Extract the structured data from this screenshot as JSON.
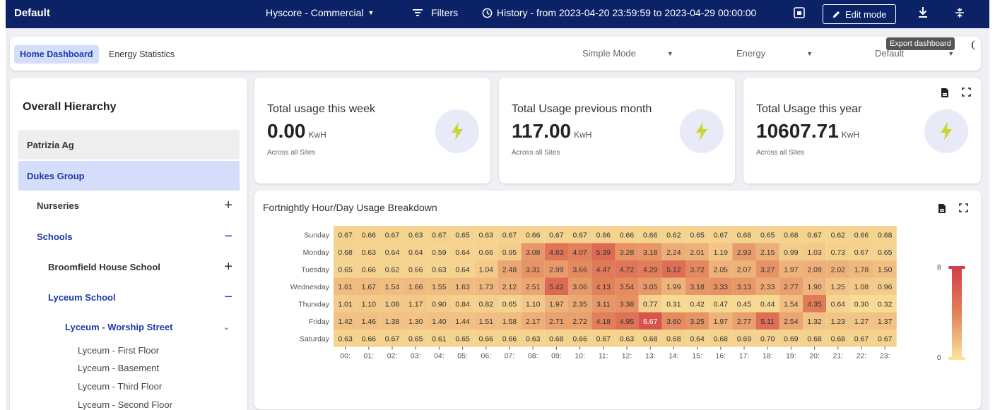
{
  "topbar": {
    "title": "Default",
    "dashboard": "Hyscore - Commercial",
    "filters": "Filters",
    "history": "History - from 2023-04-20 23:59:59 to 2023-04-29 00:00:00",
    "edit_mode": "Edit mode"
  },
  "tabs": [
    {
      "label": "Home Dashboard",
      "active": true
    },
    {
      "label": "Energy Statistics",
      "active": false
    }
  ],
  "selects": {
    "mode": "Simple Mode",
    "metric": "Energy",
    "view": "Default"
  },
  "tooltip": "Export dashboard",
  "sidebar": {
    "title": "Overall Hierarchy",
    "nodes": [
      {
        "label": "Patrizia Ag",
        "control": ""
      },
      {
        "label": "Dukes Group",
        "control": ""
      },
      {
        "label": "Nurseries",
        "control": "+"
      },
      {
        "label": "Schools",
        "control": "−"
      },
      {
        "label": "Broomfield House School",
        "control": "+"
      },
      {
        "label": "Lyceum School",
        "control": "−"
      },
      {
        "label": "Lyceum - Worship Street",
        "control": "⌄"
      }
    ],
    "leaves": [
      "Lyceum - First Floor",
      "Lyceum - Basement",
      "Lyceum - Third Floor",
      "Lyceum - Second Floor"
    ]
  },
  "cards": [
    {
      "title": "Total usage this week",
      "value": "0.00",
      "unit": "KwH",
      "sub": "Across all Sites"
    },
    {
      "title": "Total Usage previous month",
      "value": "117.00",
      "unit": "KwH",
      "sub": "Across all Sites"
    },
    {
      "title": "Total Usage this year",
      "value": "10607.71",
      "unit": "KwH",
      "sub": "Across all Sites"
    }
  ],
  "heatmap": {
    "title": "Fortnightly Hour/Day Usage Breakdown",
    "scale_max_label": "8",
    "scale_min_label": "0"
  },
  "colors": {
    "navy": "#0b2366",
    "accent_blue": "#1e3aa8",
    "tab_active_bg": "#d4defa",
    "low": "#f9e39a",
    "high": "#d33f47"
  },
  "chart_data": {
    "type": "heatmap",
    "title": "Fortnightly Hour/Day Usage Breakdown",
    "x": [
      "00:",
      "01:",
      "02:",
      "03:",
      "04:",
      "05:",
      "06:",
      "07:",
      "08:",
      "09:",
      "10:",
      "11:",
      "12:",
      "13:",
      "14:",
      "15:",
      "16:",
      "17:",
      "18:",
      "19:",
      "20:",
      "21:",
      "22:",
      "23:"
    ],
    "y": [
      "Sunday",
      "Monday",
      "Tuesday",
      "Wednesday",
      "Thursday",
      "Friday",
      "Saturday"
    ],
    "values": [
      [
        0.67,
        0.66,
        0.67,
        0.63,
        0.67,
        0.65,
        0.63,
        0.67,
        0.66,
        0.67,
        0.67,
        0.66,
        0.66,
        0.66,
        0.62,
        0.65,
        0.67,
        0.68,
        0.65,
        0.68,
        0.67,
        0.62,
        0.66,
        0.68
      ],
      [
        0.68,
        0.63,
        0.64,
        0.64,
        0.59,
        0.64,
        0.66,
        0.95,
        3.08,
        4.83,
        4.07,
        5.39,
        3.28,
        3.18,
        2.24,
        2.01,
        1.19,
        2.93,
        2.15,
        0.99,
        1.03,
        0.73,
        0.67,
        0.65
      ],
      [
        0.65,
        0.66,
        0.62,
        0.66,
        0.63,
        0.64,
        1.04,
        2.48,
        3.31,
        2.99,
        3.66,
        4.47,
        4.72,
        4.29,
        5.12,
        3.72,
        2.05,
        2.07,
        3.27,
        1.97,
        2.09,
        2.02,
        1.78,
        1.5
      ],
      [
        1.61,
        1.67,
        1.54,
        1.66,
        1.55,
        1.63,
        1.73,
        2.12,
        2.51,
        5.42,
        3.06,
        4.13,
        3.54,
        3.05,
        1.99,
        3.18,
        3.33,
        3.13,
        2.33,
        2.77,
        1.9,
        1.25,
        1.08,
        0.96
      ],
      [
        1.01,
        1.1,
        1.08,
        1.17,
        0.9,
        0.84,
        0.82,
        0.65,
        1.1,
        1.97,
        2.35,
        3.11,
        3.38,
        0.77,
        0.31,
        0.42,
        0.47,
        0.45,
        0.44,
        1.54,
        4.35,
        0.64,
        0.3,
        0.32
      ],
      [
        1.42,
        1.46,
        1.38,
        1.3,
        1.4,
        1.44,
        1.51,
        1.58,
        2.17,
        2.71,
        2.72,
        4.18,
        4.95,
        6.67,
        3.6,
        3.25,
        1.97,
        2.77,
        5.11,
        2.54,
        1.32,
        1.23,
        1.27,
        1.37
      ],
      [
        0.63,
        0.66,
        0.67,
        0.65,
        0.61,
        0.65,
        0.66,
        0.66,
        0.63,
        0.68,
        0.66,
        0.67,
        0.63,
        0.68,
        0.68,
        0.64,
        0.68,
        0.69,
        0.7,
        0.69,
        0.68,
        0.68,
        0.67,
        0.67
      ]
    ],
    "zlim": [
      0,
      8
    ]
  }
}
